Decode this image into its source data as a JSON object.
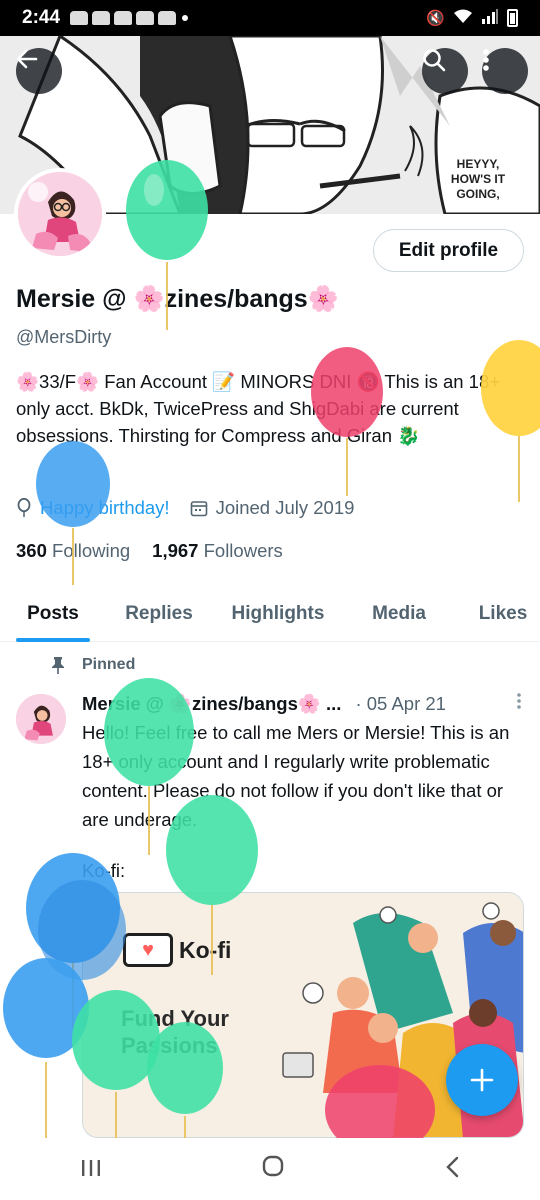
{
  "status_bar": {
    "time": "2:44"
  },
  "banner": {
    "speech_text": [
      "HEYYY,",
      "HOW'S IT",
      "GOING,"
    ]
  },
  "profile": {
    "edit_label": "Edit profile",
    "name": "Mersie @ 🌸zines/bangs🌸",
    "handle": "@MersDirty",
    "bio": "🌸33/F🌸 Fan Account 📝 MINORS DNI 🔞 This is an 18+ only acct. BkDk, TwicePress and ShigDabi are current obsessions. Thirsting for Compress and Giran 🐉",
    "birthday": "Happy birthday!",
    "joined": "Joined July 2019",
    "following_count": "360",
    "following_label": "Following",
    "followers_count": "1,967",
    "followers_label": "Followers"
  },
  "tabs": [
    {
      "label": "Posts"
    },
    {
      "label": "Replies"
    },
    {
      "label": "Highlights"
    },
    {
      "label": "Media"
    },
    {
      "label": "Likes"
    }
  ],
  "pinned_post": {
    "pinned_label": "Pinned",
    "author": "Mersie @ 🌸zines/bangs🌸 ...",
    "date": "· 05 Apr 21",
    "text": "Hello! Feel free to call me Mers or Mersie! This is an 18+ only account and I regularly write problematic content. Please do not follow if you don't like that or are underage.",
    "kofi_label": "Ko-fi:",
    "card": {
      "brand": "Ko-fi",
      "tagline": "Fund Your Passions"
    }
  },
  "colors": {
    "accent": "#1d9bf0",
    "balloon_green": "#3ee0a4",
    "balloon_blue": "#3a9ef0",
    "balloon_red": "#ef3f6b",
    "balloon_yellow": "#ffd23f"
  },
  "icons": [
    "back-arrow-icon",
    "search-icon",
    "more-vertical-icon",
    "balloon-icon",
    "calendar-icon",
    "pin-icon",
    "plus-icon"
  ]
}
